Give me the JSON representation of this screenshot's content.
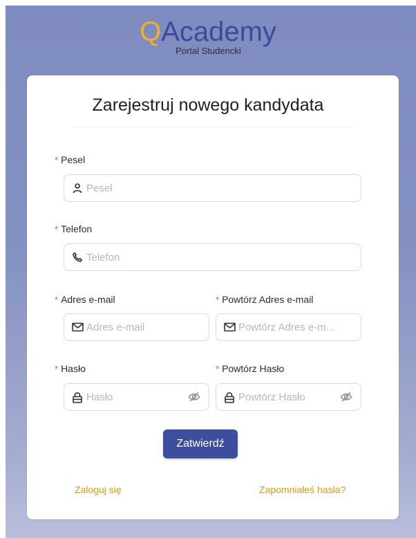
{
  "logo": {
    "letter": "Q",
    "rest": "Academy",
    "subtitle": "Portal Studencki"
  },
  "form": {
    "title": "Zarejestruj nowego kandydata",
    "required_mark": "*",
    "pesel": {
      "label": "Pesel",
      "placeholder": "Pesel"
    },
    "phone": {
      "label": "Telefon",
      "placeholder": "Telefon"
    },
    "email": {
      "label": "Adres e-mail",
      "placeholder": "Adres e-mail"
    },
    "email_repeat": {
      "label": "Powtórz Adres e-mail",
      "placeholder": "Powtórz Adres e-m..."
    },
    "password": {
      "label": "Hasło",
      "placeholder": "Hasło"
    },
    "password_repeat": {
      "label": "Powtórz Hasło",
      "placeholder": "Powtórz Hasło"
    },
    "submit_label": "Zatwierdź"
  },
  "links": {
    "login": "Zaloguj się",
    "forgot": "Zapomniałeś hasła?"
  },
  "colors": {
    "accent": "#3d4e9f",
    "logo_orange": "#f1ad2b",
    "link": "#d49b12",
    "required": "#ff4d4f"
  },
  "icons": {
    "pesel": "user-icon",
    "phone": "phone-icon",
    "email": "mail-icon",
    "password": "lock-icon",
    "visibility": "eye-slash-icon"
  }
}
